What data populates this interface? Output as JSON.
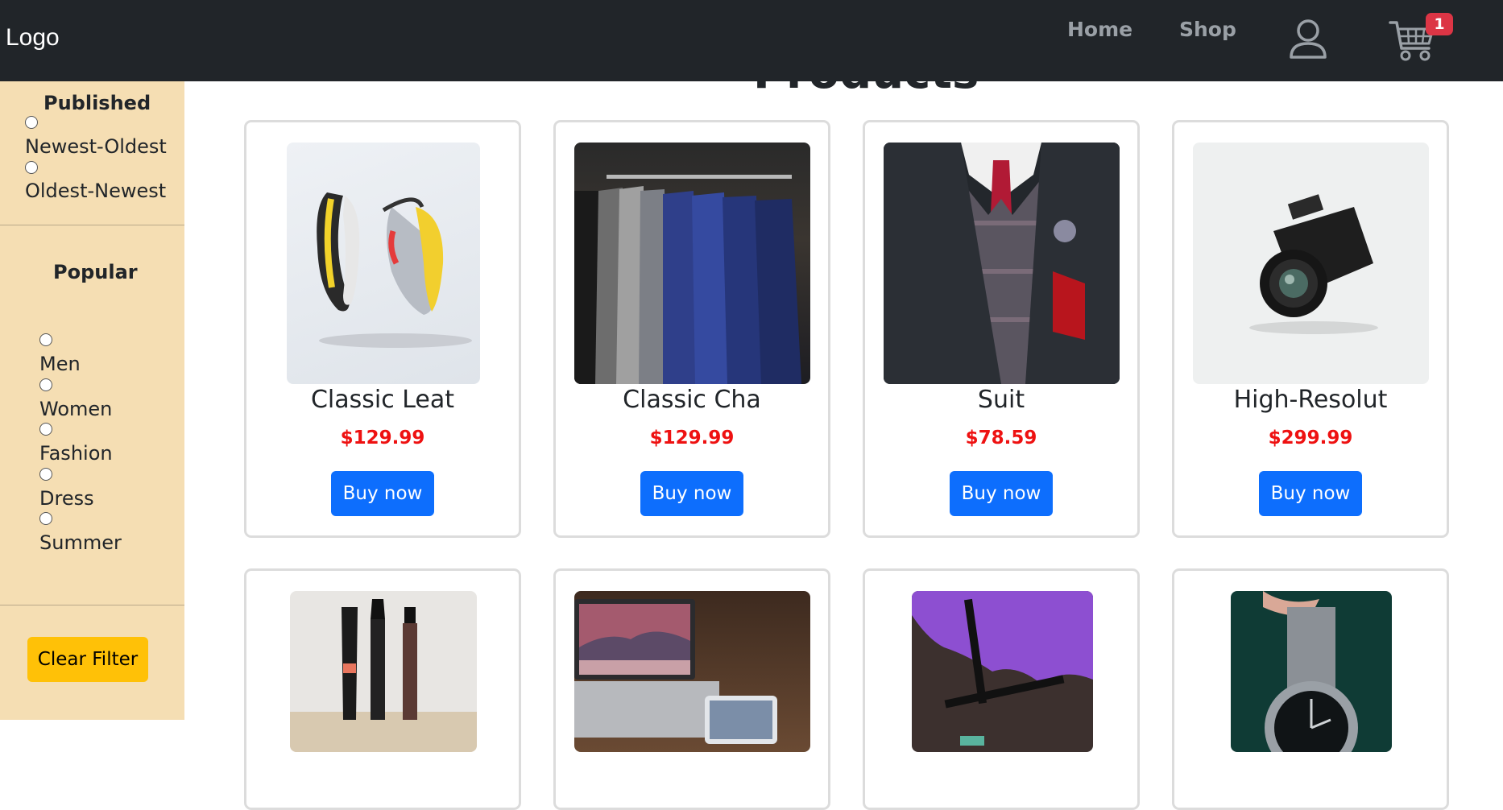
{
  "navbar": {
    "logo": "Logo",
    "links": [
      "Home",
      "Shop"
    ],
    "cart_count": "1",
    "icons": [
      "user-icon",
      "cart-icon"
    ]
  },
  "sidebar": {
    "published_heading": "Published",
    "published_options": [
      "Newest-Oldest",
      "Oldest-Newest"
    ],
    "popular_heading": "Popular",
    "popular_options": [
      "Men",
      "Women",
      "Fashion",
      "Dress",
      "Summer"
    ],
    "clear_label": "Clear Filter"
  },
  "page_heading": "Products",
  "products": [
    {
      "name": "Classic Leat",
      "price": "$129.99",
      "button": "Buy now"
    },
    {
      "name": "Classic Cha",
      "price": "$129.99",
      "button": "Buy now"
    },
    {
      "name": "Suit",
      "price": "$78.59",
      "button": "Buy now"
    },
    {
      "name": "High-Resolut",
      "price": "$299.99",
      "button": "Buy now"
    }
  ],
  "colors": {
    "navbar": "#212529",
    "sidebar": "#f5deb3",
    "price": "#ee1111",
    "buy_button": "#0d6efd",
    "clear_button": "#ffc107",
    "badge": "#dc3545"
  }
}
